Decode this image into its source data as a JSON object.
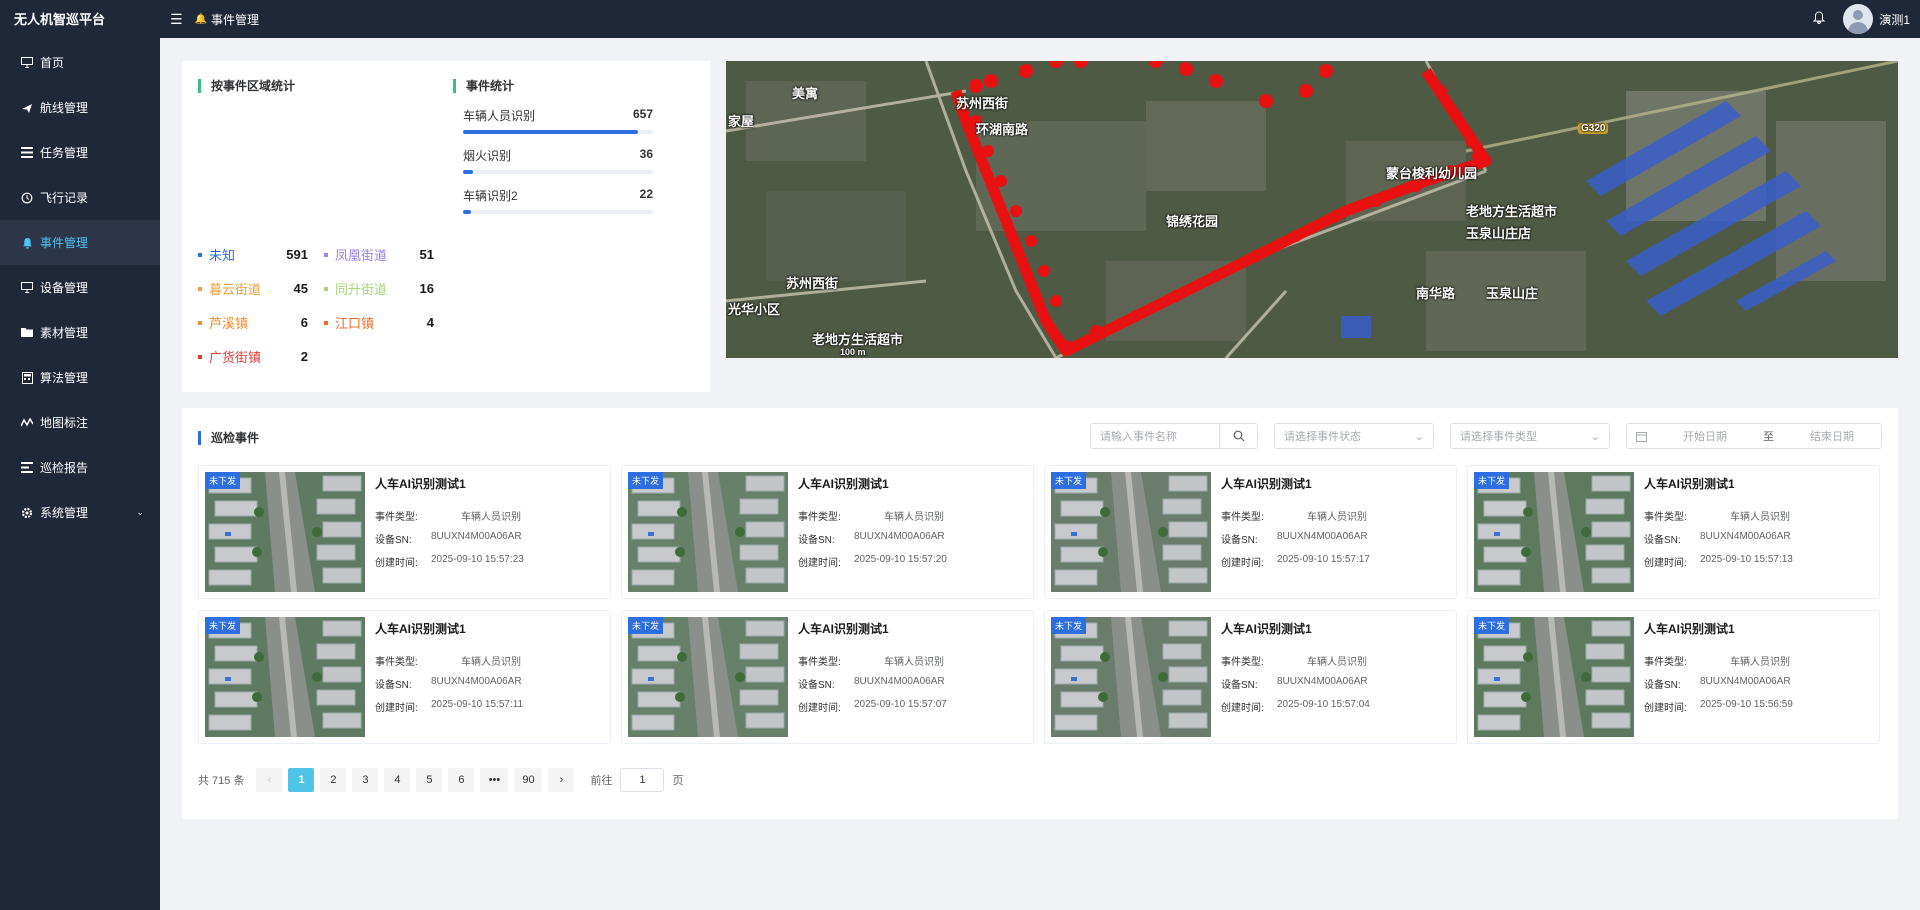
{
  "app": {
    "title": "无人机智巡平台"
  },
  "sidebar": {
    "items": [
      {
        "label": "首页",
        "icon": "monitor-icon"
      },
      {
        "label": "航线管理",
        "icon": "plane-icon"
      },
      {
        "label": "任务管理",
        "icon": "list-icon"
      },
      {
        "label": "飞行记录",
        "icon": "history-icon"
      },
      {
        "label": "事件管理",
        "icon": "bell-icon",
        "active": true
      },
      {
        "label": "设备管理",
        "icon": "monitor-icon"
      },
      {
        "label": "素材管理",
        "icon": "folder-icon"
      },
      {
        "label": "算法管理",
        "icon": "calculator-icon"
      },
      {
        "label": "地图标注",
        "icon": "map-icon"
      },
      {
        "label": "巡检报告",
        "icon": "report-icon"
      },
      {
        "label": "系统管理",
        "icon": "gear-icon"
      }
    ]
  },
  "topbar": {
    "breadcrumb": "事件管理",
    "username": "演测1"
  },
  "area_stats": {
    "title": "按事件区域统计",
    "items": [
      {
        "name": "未知",
        "value": "591",
        "color": "#2d6fe0"
      },
      {
        "name": "凤凰街道",
        "value": "51",
        "color": "#9b7fe6"
      },
      {
        "name": "暮云街道",
        "value": "45",
        "color": "#e6a23c"
      },
      {
        "name": "同升街道",
        "value": "16",
        "color": "#a8d47a"
      },
      {
        "name": "芦溪镇",
        "value": "6",
        "color": "#f08c2a"
      },
      {
        "name": "江口镇",
        "value": "4",
        "color": "#f06a2a"
      },
      {
        "name": "广货街镇",
        "value": "2",
        "color": "#e63a3a"
      }
    ]
  },
  "event_stats": {
    "title": "事件统计",
    "items": [
      {
        "name": "车辆人员识别",
        "value": "657",
        "fraction": 0.92
      },
      {
        "name": "烟火识别",
        "value": "36",
        "fraction": 0.05
      },
      {
        "name": "车辆识别2",
        "value": "22",
        "fraction": 0.03
      }
    ]
  },
  "map": {
    "labels": [
      "美寓",
      "苏州西街",
      "环湖南路",
      "蒙台梭利幼儿园",
      "老地方生活超市",
      "玉泉山庄店",
      "锦绣花园",
      "苏州西街",
      "光华小区",
      "老地方生活超市",
      "100 m",
      "G320",
      "南华路",
      "玉泉山庄",
      "家屋"
    ]
  },
  "patrol": {
    "title": "巡检事件",
    "search_placeholder": "请输入事件名称",
    "status_placeholder": "请选择事件状态",
    "type_placeholder": "请选择事件类型",
    "start_placeholder": "开始日期",
    "date_sep": "至",
    "end_placeholder": "结束日期",
    "labels": {
      "type": "事件类型:",
      "sn": "设备SN:",
      "time": "创建时间:"
    },
    "cards": [
      {
        "badge": "未下发",
        "title": "人车AI识别测试1",
        "type": "车辆人员识别",
        "sn": "8UUXN4M00A06AR",
        "time": "2025-09-10 15:57:23"
      },
      {
        "badge": "未下发",
        "title": "人车AI识别测试1",
        "type": "车辆人员识别",
        "sn": "8UUXN4M00A06AR",
        "time": "2025-09-10 15:57:20"
      },
      {
        "badge": "未下发",
        "title": "人车AI识别测试1",
        "type": "车辆人员识别",
        "sn": "8UUXN4M00A06AR",
        "time": "2025-09-10 15:57:17"
      },
      {
        "badge": "未下发",
        "title": "人车AI识别测试1",
        "type": "车辆人员识别",
        "sn": "8UUXN4M00A06AR",
        "time": "2025-09-10 15:57:13"
      },
      {
        "badge": "未下发",
        "title": "人车AI识别测试1",
        "type": "车辆人员识别",
        "sn": "8UUXN4M00A06AR",
        "time": "2025-09-10 15:57:11"
      },
      {
        "badge": "未下发",
        "title": "人车AI识别测试1",
        "type": "车辆人员识别",
        "sn": "8UUXN4M00A06AR",
        "time": "2025-09-10 15:57:07"
      },
      {
        "badge": "未下发",
        "title": "人车AI识别测试1",
        "type": "车辆人员识别",
        "sn": "8UUXN4M00A06AR",
        "time": "2025-09-10 15:57:04"
      },
      {
        "badge": "未下发",
        "title": "人车AI识别测试1",
        "type": "车辆人员识别",
        "sn": "8UUXN4M00A06AR",
        "time": "2025-09-10 15:56:59"
      }
    ]
  },
  "pagination": {
    "total_text": "共 715 条",
    "pages": [
      "1",
      "2",
      "3",
      "4",
      "5",
      "6",
      "•••",
      "90"
    ],
    "current": "1",
    "goto_prefix": "前往",
    "goto_value": "1",
    "goto_suffix": "页"
  }
}
